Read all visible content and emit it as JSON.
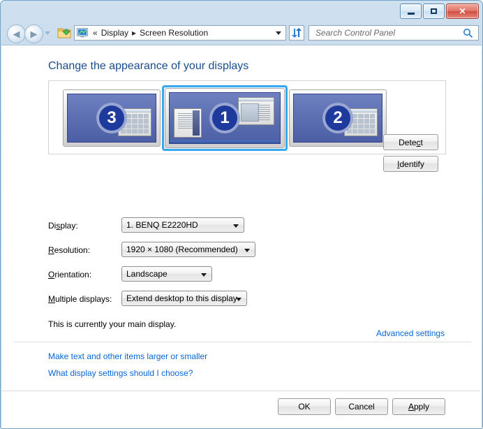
{
  "window": {
    "controls": {
      "minimize": "minimize",
      "maximize": "maximize",
      "close": "✕"
    }
  },
  "navbar": {
    "back_arrow": "◀",
    "forward_arrow": "▶",
    "breadcrumb": {
      "prefix": "«",
      "separator": "▸",
      "items": [
        "Display",
        "Screen Resolution"
      ]
    },
    "refresh_icon": "refresh-icon",
    "search": {
      "placeholder": "Search Control Panel",
      "value": "",
      "icon": "search-icon"
    }
  },
  "page": {
    "heading": "Change the appearance of your displays"
  },
  "monitors": [
    {
      "number": "3",
      "selected": false,
      "name": "monitor-3"
    },
    {
      "number": "1",
      "selected": true,
      "name": "monitor-1"
    },
    {
      "number": "2",
      "selected": false,
      "name": "monitor-2"
    }
  ],
  "side_buttons": {
    "detect": {
      "pre": "Dete",
      "accel": "c",
      "post": "t",
      "full": "Detect"
    },
    "identify": {
      "pre": "",
      "accel": "I",
      "post": "dentify",
      "full": "Identify"
    }
  },
  "form": {
    "display": {
      "label_pre": "Di",
      "label_accel": "s",
      "label_post": "play:",
      "value": "1. BENQ E2220HD"
    },
    "resolution": {
      "label_pre": "",
      "label_accel": "R",
      "label_post": "esolution:",
      "value": "1920 × 1080 (Recommended)"
    },
    "orientation": {
      "label_pre": "",
      "label_accel": "O",
      "label_post": "rientation:",
      "value": "Landscape"
    },
    "multiple_displays": {
      "label_pre": "",
      "label_accel": "M",
      "label_post": "ultiple displays:",
      "value": "Extend desktop to this display"
    }
  },
  "status": {
    "main_display_text": "This is currently your main display."
  },
  "links": {
    "advanced_settings": "Advanced settings",
    "make_text_larger": "Make text and other items larger or smaller",
    "what_settings": "What display settings should I choose?"
  },
  "dialog_buttons": {
    "ok": {
      "full": "OK"
    },
    "cancel": {
      "full": "Cancel"
    },
    "apply": {
      "pre": "",
      "accel": "A",
      "post": "pply",
      "full": "Apply"
    }
  },
  "colors": {
    "accent_blue": "#35a8f0",
    "heading_blue": "#1a4d8f",
    "link_blue": "#0566d6",
    "screen_blue": "#4c5fa5",
    "badge_blue": "#1e3a9c",
    "close_red": "#cf4f41"
  }
}
